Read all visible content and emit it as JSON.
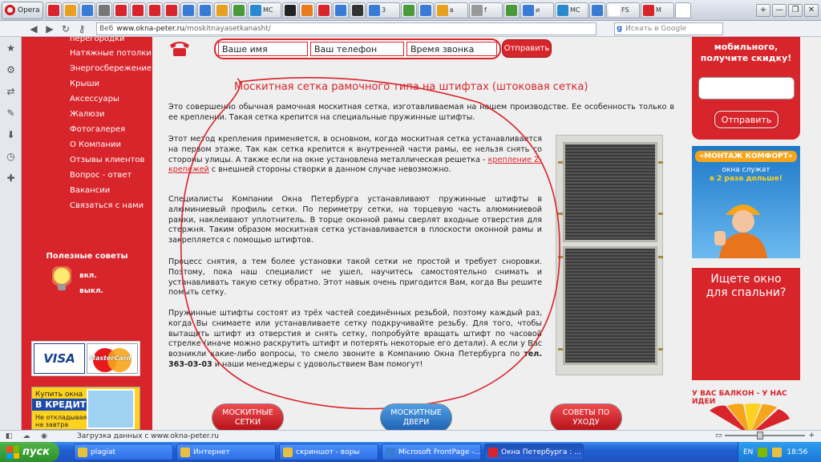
{
  "browser": {
    "opera_label": "Opera",
    "tabs": [
      {
        "label": "",
        "color": "#d8242b"
      },
      {
        "label": "",
        "color": "#e8a020"
      },
      {
        "label": "",
        "color": "#3a7bd5"
      },
      {
        "label": "",
        "color": "#777777"
      },
      {
        "label": "",
        "color": "#d8242b"
      },
      {
        "label": "",
        "color": "#d8242b"
      },
      {
        "label": "",
        "color": "#d8242b"
      },
      {
        "label": "",
        "color": "#d8242b"
      },
      {
        "label": "",
        "color": "#3a7bd5"
      },
      {
        "label": "",
        "color": "#3a7bd5"
      },
      {
        "label": "",
        "color": "#e8a020"
      },
      {
        "label": "",
        "color": "#4a9a3a"
      },
      {
        "label": "MC",
        "color": "#2a8ad0"
      },
      {
        "label": "",
        "color": "#222222"
      },
      {
        "label": "",
        "color": "#e87a20"
      },
      {
        "label": "",
        "color": "#d8242b"
      },
      {
        "label": "",
        "color": "#3a7bd5"
      },
      {
        "label": "",
        "color": "#333333"
      },
      {
        "label": "3",
        "color": "#3a7bd5"
      },
      {
        "label": "",
        "color": "#4a9a3a"
      },
      {
        "label": "",
        "color": "#3a7bd5"
      },
      {
        "label": "в",
        "color": "#e8a020"
      },
      {
        "label": "f",
        "color": "#999999"
      },
      {
        "label": "",
        "color": "#4a9a3a"
      },
      {
        "label": "и",
        "color": "#3a7bd5"
      },
      {
        "label": "MC",
        "color": "#2a8ad0"
      },
      {
        "label": "",
        "color": "#3a7bd5"
      },
      {
        "label": "FS",
        "color": "#ffffff"
      },
      {
        "label": "M",
        "color": "#d8242b"
      },
      {
        "label": "",
        "color": "#ffffff"
      }
    ],
    "url_prefix": "Веб",
    "url_host": "www.okna-peter.ru",
    "url_path": "/moskitnayasetkanasht/",
    "search_placeholder": "Искать в Google",
    "win_min": "—",
    "win_max": "❐",
    "win_close": "✕",
    "new_tab": "+"
  },
  "left_menu": {
    "items": [
      "перегородки",
      "Натяжные потолки",
      "Энергосбережение",
      "Крыши",
      "Аксессуары",
      "Жалюзи",
      "Фотогалерея",
      "О Компании",
      "Отзывы клиентов",
      "Вопрос - ответ",
      "Вакансии",
      "Связаться с нами"
    ],
    "tips_title": "Полезные советы",
    "tips_on": "вкл.",
    "tips_off": "выкл.",
    "visa": "VISA",
    "mastercard": "MasterCard",
    "credit_line1": "Купить окна",
    "credit_line2": "В КРЕДИТ",
    "credit_line3": "Не откладывая",
    "credit_line4": "на завтра"
  },
  "callback": {
    "name_field": "Ваше имя",
    "phone_field": "Ваш телефон",
    "time_field": "Время звонка",
    "send_label": "Отправить"
  },
  "article": {
    "title": "Москитная сетка рамочного типа на штифтах (штоковая сетка)",
    "p1": "Это совершенно обычная рамочная москитная сетка, изготавливаемая на нашем производстве. Ее особенность только в ее креплении. Такая сетка крепится на специальные пружинные штифты.",
    "p2a": "Этот метод крепления применяется, в основном, когда москитная сетка устанавливается на первом этаже. Так как сетка крепится к внутренней части рамы, ее нельзя снять со стороны улицы. А также если на окне установлена металлическая решетка -",
    "p2_link": "крепление Z-крепежей",
    "p2b": "с внешней стороны створки в данном случае невозможно.",
    "p3": "Специалисты Компании Окна Петербурга устанавливают пружинные штифты в алюминиевый профиль сетки. По периметру сетки, на торцевую часть алюминиевой рамки, наклеивают уплотнитель. В торце оконной рамы сверлят входные отверстия для стержня. Таким образом москитная сетка устанавливается в плоскости оконной рамы и закрепляется с помощью штифтов.",
    "p4": "Процесс снятия, а тем более установки такой сетки не простой и требует сноровки. Поэтому, пока наш специалист не ушел, научитесь самостоятельно снимать и устанавливать такую сетку обратно. Этот навык очень пригодится Вам, когда Вы решите помыть сетку.",
    "p5a": "Пружинные штифты состоят из трёх частей соединённых резьбой, поэтому каждый раз, когда Вы снимаете или устанавливаете сетку подкручивайте резьбу. Для того, чтобы вытащить штифт из отверстия и снять сетку, попробуйте вращать штифт по часовой стрелке (иначе можно раскрутить штифт и потерять некоторые его детали). А если у Вас возникли какие-либо вопросы, то смело звоните в Компанию Окна Петербурга по",
    "p5_phone": "тел. 363-03-03",
    "p5b": "и наши менеджеры с удовольствием Вам помогут!",
    "btn1_l1": "МОСКИТНЫЕ",
    "btn1_l2": "СЕТКИ",
    "btn2_l1": "МОСКИТНЫЕ",
    "btn2_l2": "ДВЕРИ",
    "btn3_l1": "СОВЕТЫ ПО",
    "btn3_l2": "УХОДУ"
  },
  "right_col": {
    "promo_l1": "мобильного,",
    "promo_l2": "получите скидку!",
    "promo_send": "Отправить",
    "montazh_title": "«МОНТАЖ КОМФОРТ»",
    "montazh_l1": "окна служат",
    "montazh_l2": "в 2 раза дольше!",
    "bedroom_l1": "Ищете окно",
    "bedroom_l2": "для спальни?",
    "balcony": "У ВАС БАЛКОН - У НАС ИДЕИ"
  },
  "status": {
    "text": "Загрузка данных с www.okna-peter.ru"
  },
  "taskbar": {
    "start": "пуск",
    "tasks": [
      {
        "label": "plagiat",
        "color": "#e8c040"
      },
      {
        "label": "Интернет",
        "color": "#e8c040"
      },
      {
        "label": "скриншот - воры",
        "color": "#e8c040"
      },
      {
        "label": "Microsoft FrontPage -...",
        "color": "#3a7bd5"
      },
      {
        "label": "Окна Петербурга : ...",
        "color": "#d8242b"
      }
    ],
    "lang": "EN",
    "clock": "18:56"
  }
}
